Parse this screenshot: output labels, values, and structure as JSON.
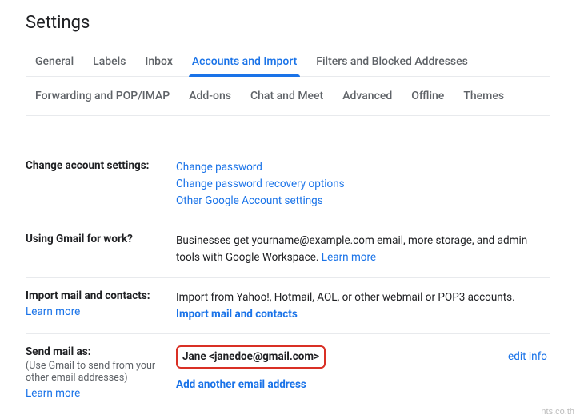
{
  "page": {
    "title": "Settings"
  },
  "tabs": {
    "row1": [
      {
        "label": "General"
      },
      {
        "label": "Labels"
      },
      {
        "label": "Inbox"
      },
      {
        "label": "Accounts and Import",
        "active": true
      },
      {
        "label": "Filters and Blocked Addresses"
      }
    ],
    "row2": [
      {
        "label": "Forwarding and POP/IMAP"
      },
      {
        "label": "Add-ons"
      },
      {
        "label": "Chat and Meet"
      },
      {
        "label": "Advanced"
      },
      {
        "label": "Offline"
      },
      {
        "label": "Themes"
      }
    ]
  },
  "sections": {
    "change_account": {
      "label": "Change account settings:",
      "links": {
        "change_password": "Change password",
        "recovery": "Change password recovery options",
        "other": "Other Google Account settings"
      }
    },
    "gmail_work": {
      "label": "Using Gmail for work?",
      "text": "Businesses get yourname@example.com email, more storage, and admin tools with Google Workspace. ",
      "learn_more": "Learn more"
    },
    "import": {
      "label": "Import mail and contacts:",
      "learn_more": "Learn more",
      "text": "Import from Yahoo!, Hotmail, AOL, or other webmail or POP3 accounts.",
      "action": "Import mail and contacts"
    },
    "send_mail_as": {
      "label": "Send mail as:",
      "sub": "(Use Gmail to send from your other email addresses)",
      "learn_more": "Learn more",
      "identity": "Jane <janedoe@gmail.com>",
      "edit": "edit info",
      "add": "Add another email address"
    }
  },
  "watermark": "nts.co.th"
}
